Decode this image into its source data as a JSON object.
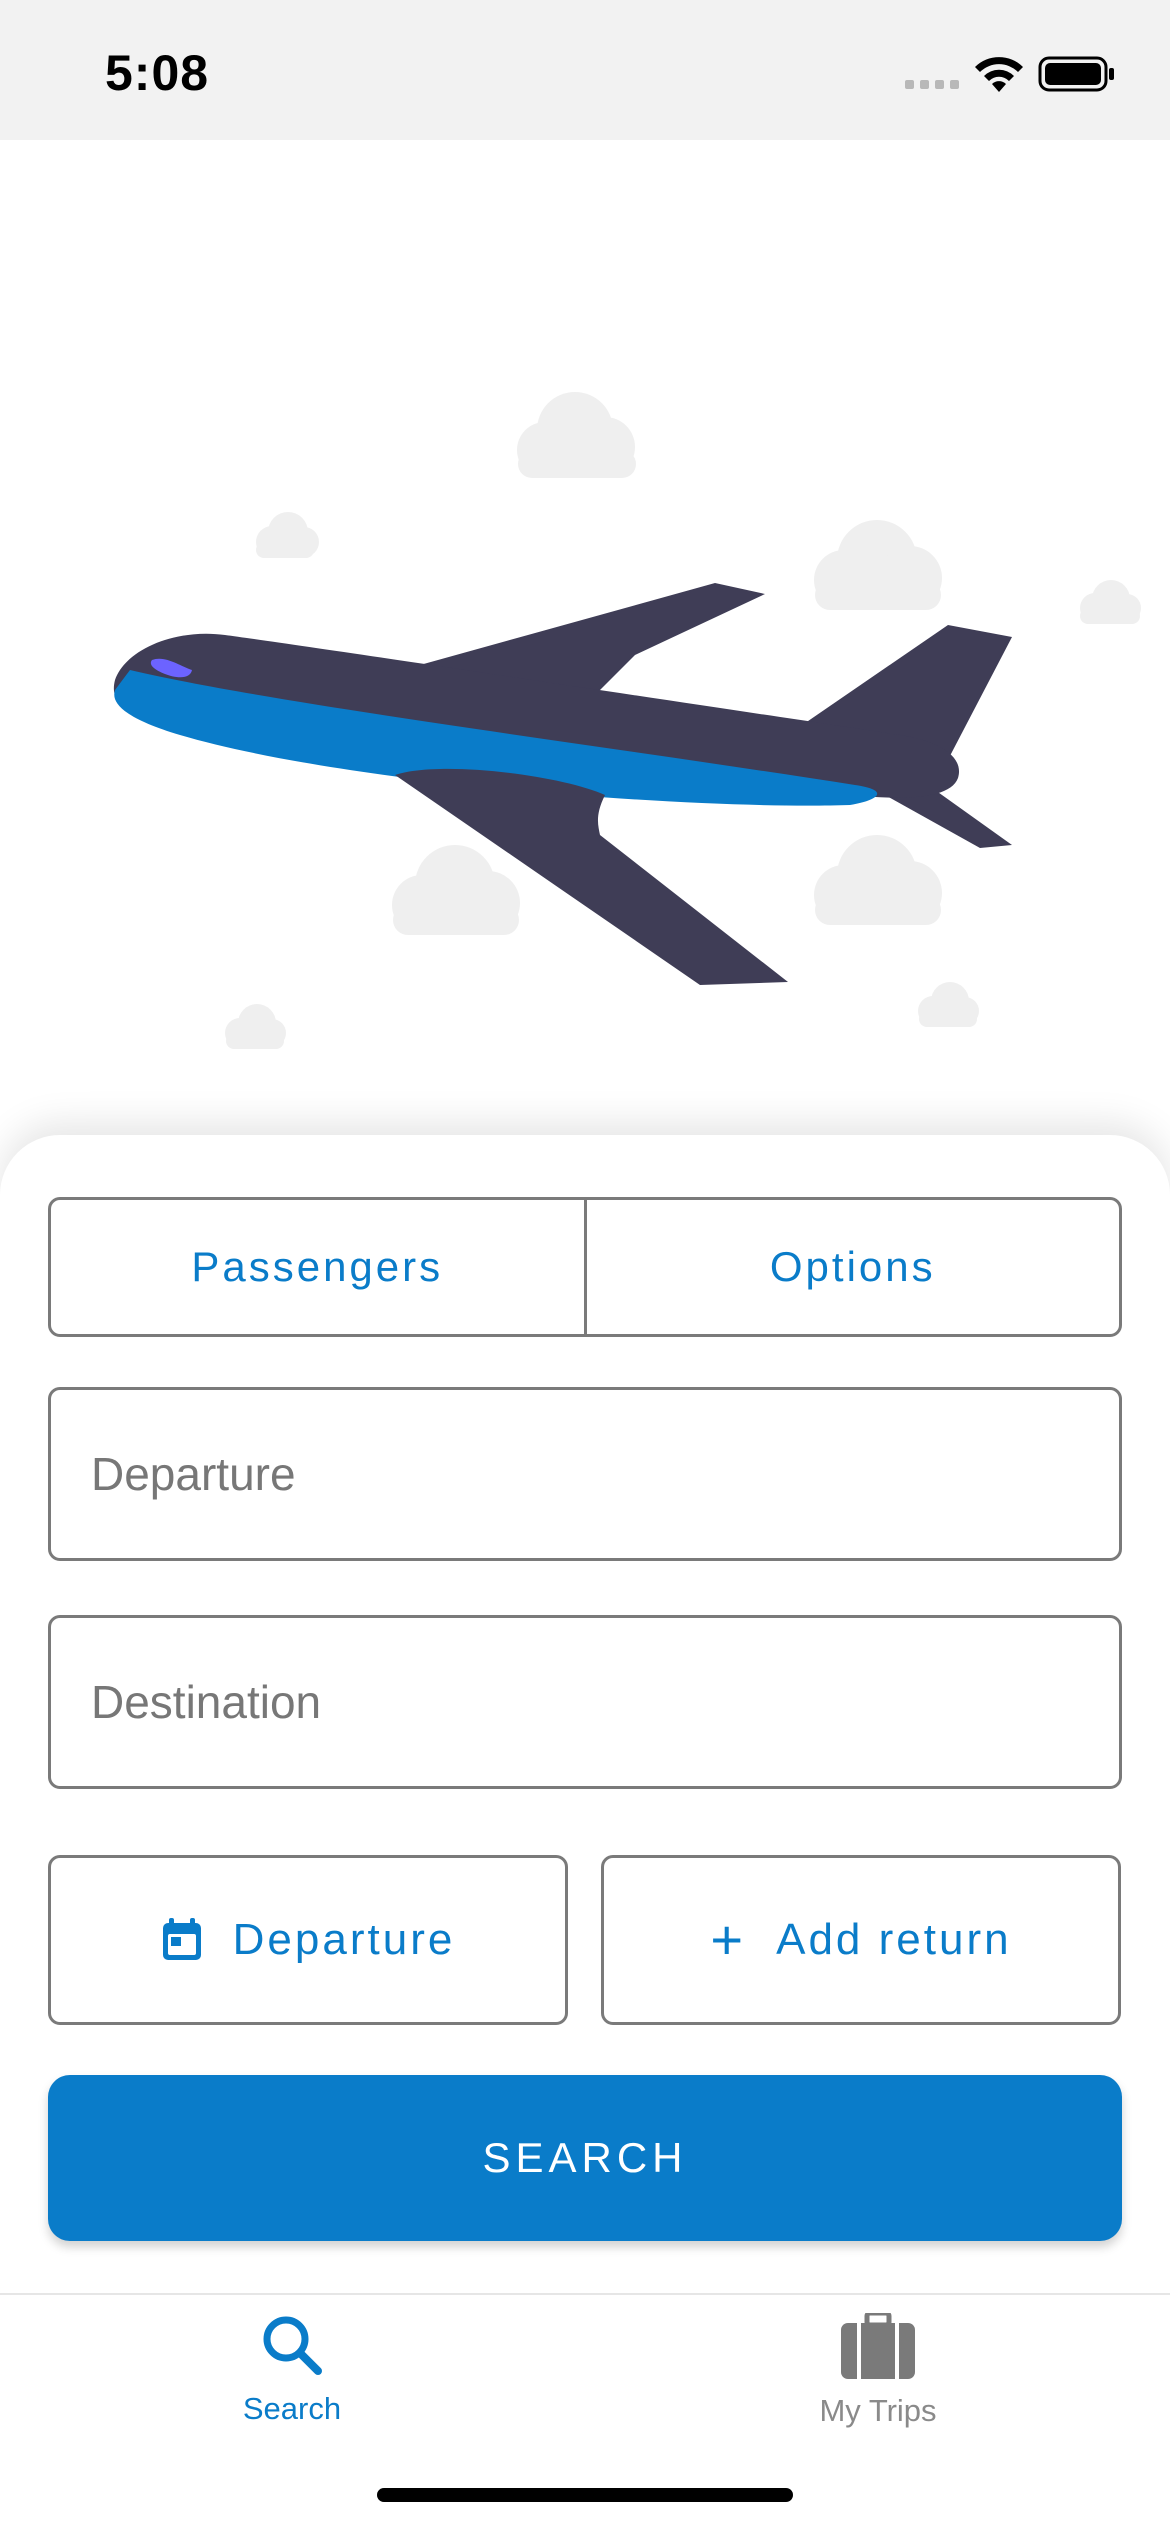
{
  "status_bar": {
    "time": "5:08"
  },
  "hero": {
    "illustration": "airplane-in-clouds"
  },
  "segmented": {
    "passengers_label": "Passengers",
    "options_label": "Options"
  },
  "form": {
    "departure_placeholder": "Departure",
    "departure_value": "",
    "destination_placeholder": "Destination",
    "destination_value": ""
  },
  "dates": {
    "departure_label": "Departure",
    "add_return_label": "Add return",
    "plus_symbol": "+"
  },
  "actions": {
    "search_label": "SEARCH"
  },
  "tabbar": {
    "tabs": [
      {
        "label": "Search",
        "icon": "search-icon",
        "active": true
      },
      {
        "label": "My Trips",
        "icon": "suitcase-icon",
        "active": false
      }
    ]
  },
  "colors": {
    "accent": "#0a7cc9",
    "plane_body": "#3f3d56",
    "plane_stripe": "#0a7cc9",
    "cockpit": "#6c63ff",
    "cloud": "#f0f0f0",
    "border": "#7a7a7a"
  }
}
